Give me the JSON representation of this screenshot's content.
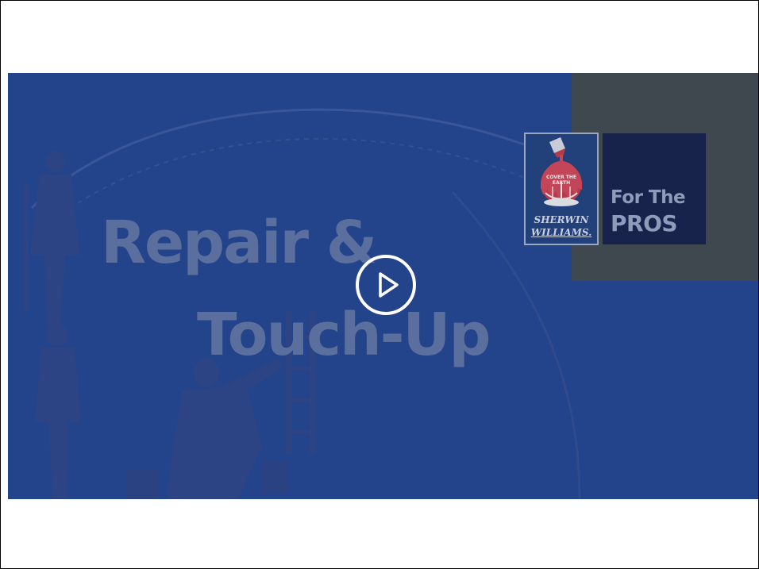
{
  "video": {
    "title_line_1": "Repair &",
    "title_line_2": "Touch-Up",
    "background_color": "#23448a",
    "title_color": "#5b6f9e",
    "play_icon": "play-icon"
  },
  "brand": {
    "logo_name_line_1": "SHERWIN",
    "logo_name_line_2": "WILLIAMS.",
    "tagline_line_1": "For The",
    "tagline_line_2": "PROS",
    "logo_icon": "cover-the-earth-logo-icon",
    "panel_color": "#3e484e"
  }
}
